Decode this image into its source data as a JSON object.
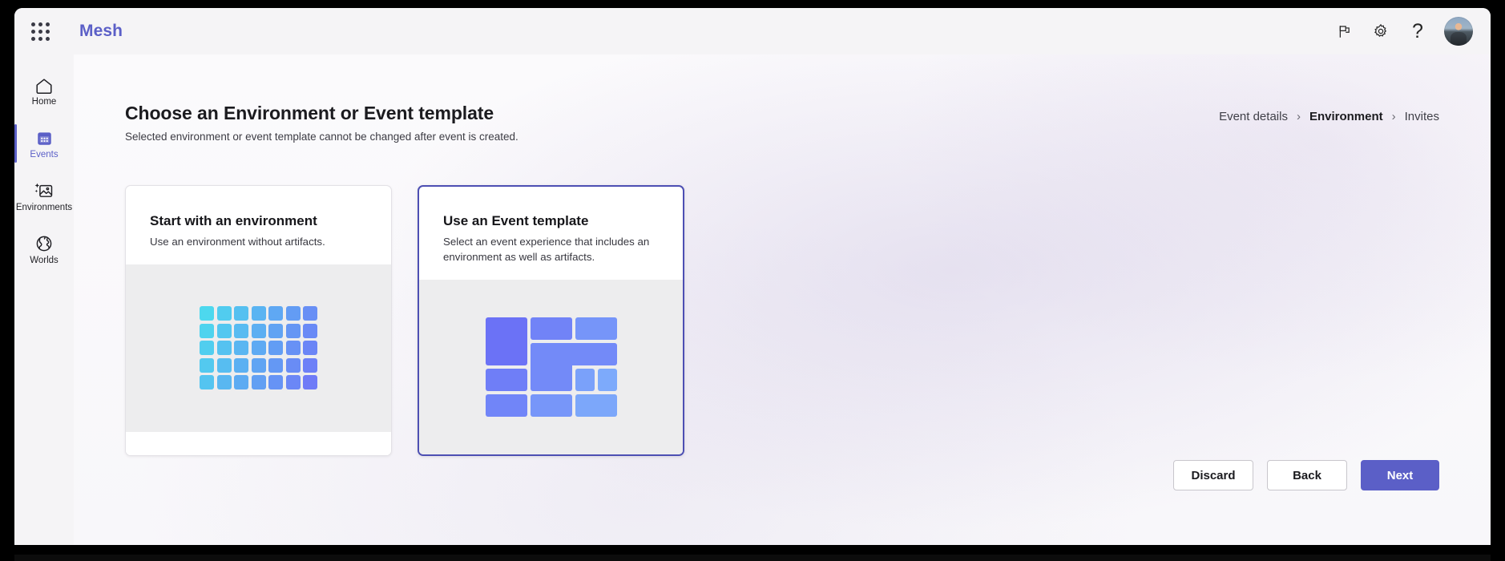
{
  "topbar": {
    "waffle_icon": "waffle-grid-icon",
    "brand": "Mesh",
    "actions": [
      {
        "icon": "flag-icon",
        "name": "feedback-button"
      },
      {
        "icon": "gear-icon",
        "name": "settings-button"
      },
      {
        "icon": "question-mark-icon",
        "name": "help-button",
        "glyph": "?"
      }
    ],
    "avatar": "user-avatar"
  },
  "sidebar": {
    "items": [
      {
        "label": "Home",
        "icon": "home-icon",
        "selected": false
      },
      {
        "label": "Events",
        "icon": "calendar-icon",
        "selected": true
      },
      {
        "label": "Environments",
        "icon": "image-sparkle-icon",
        "selected": false
      },
      {
        "label": "Worlds",
        "icon": "globe-icon",
        "selected": false
      }
    ]
  },
  "page": {
    "title": "Choose an Environment or Event template",
    "subtitle": "Selected environment or event template cannot be changed after event is created."
  },
  "breadcrumb": {
    "items": [
      {
        "label": "Event details",
        "active": false
      },
      {
        "label": "Environment",
        "active": true
      },
      {
        "label": "Invites",
        "active": false
      }
    ],
    "separator": "›"
  },
  "cards": [
    {
      "title": "Start with an environment",
      "description": "Use an environment without artifacts.",
      "selected": false,
      "art": "grid-tiles"
    },
    {
      "title": "Use an Event template",
      "description": "Select an event experience that includes an environment as well as artifacts.",
      "selected": true,
      "art": "mosaic-tiles"
    }
  ],
  "footer": {
    "discard_label": "Discard",
    "back_label": "Back",
    "next_label": "Next"
  },
  "colors": {
    "accent": "#5b5fc7",
    "selected_border": "#4d4fb3",
    "topbar_bg": "#f5f4f6",
    "content_bg": "#faf9fb",
    "art_bg": "#ededee",
    "grid_from": "#4dd8ee",
    "grid_to": "#6f7bf7",
    "mosaic_from": "#6b72f6",
    "mosaic_to": "#7fb0fb"
  }
}
